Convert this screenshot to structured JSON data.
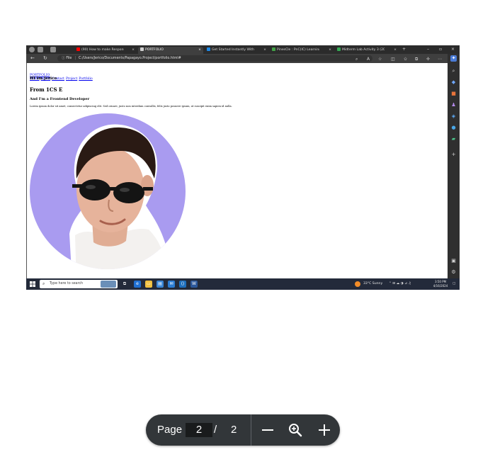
{
  "browser": {
    "tabs": [
      {
        "label": "(90) How to make Responsive R",
        "favicon": "youtube-icon",
        "color": "#ff0000"
      },
      {
        "label": "PORTFOLIO",
        "favicon": "page-icon",
        "color": "#cfcfcf",
        "active": true
      },
      {
        "label": "Get Started Instantly With 1,000",
        "favicon": "site-icon",
        "color": "#1e88e5"
      },
      {
        "label": "PinesCle : PnC(IC) Learning Ma",
        "favicon": "school-icon",
        "color": "#43a047"
      },
      {
        "label": "Midterm Lab Activity 3 (20240)",
        "favicon": "drive-icon",
        "color": "#34a853"
      }
    ],
    "url_label": "File",
    "url": "C:/Users/Jerico/Documents/Papagayo.Project/portfolio.html#"
  },
  "page": {
    "nav_brand": "PORTFOLIO",
    "nav_links": [
      "Home",
      "About",
      "Contact",
      "Project",
      "Portfolio"
    ],
    "greeting": "HI Im Jerico",
    "origin": "From 1CS E",
    "role": "And I'm a Frontend Developer",
    "bio": "Lorem ipsum dolor sit amet, consectetur adipiscing elit. Sed ornare, justo non interdum convallis, felis justo posuere ipsum, ut suscipit enim sapien id nulla."
  },
  "taskbar": {
    "search_placeholder": "Type here to search",
    "weather": "33°C  Sunny",
    "time": "3:50 PM",
    "date": "4/16/2024"
  },
  "pdf_viewer": {
    "page_label": "Page",
    "current_page": "2",
    "separator": "/",
    "total_pages": "2"
  },
  "colors": {
    "avatar_bg": "#a99bf0",
    "pdf_toolbar_bg": "#323639",
    "link": "#0000ee"
  }
}
